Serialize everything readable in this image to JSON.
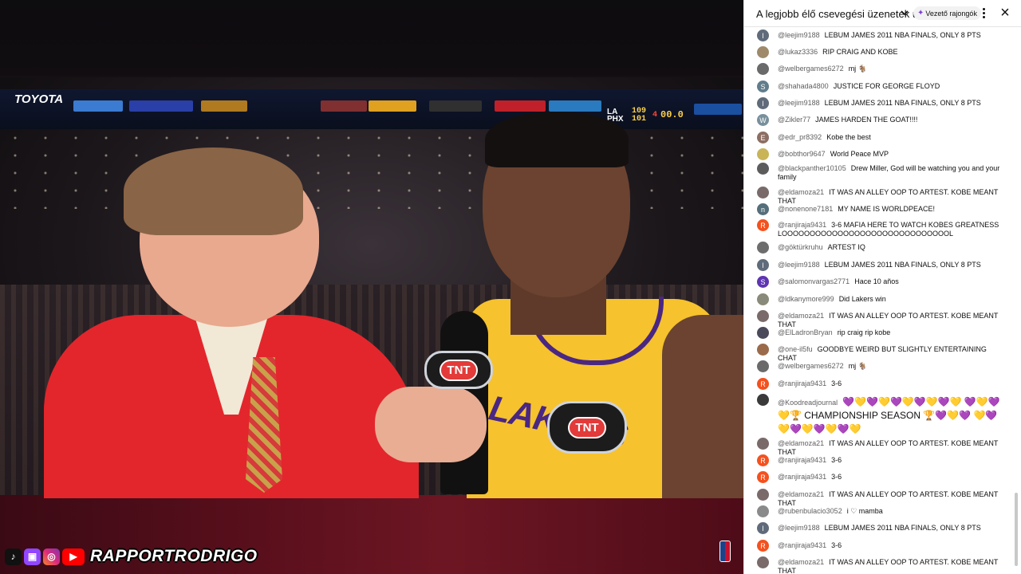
{
  "video": {
    "channel_name": "RAPPORTRODRIGO",
    "social_icons": [
      "tiktok-icon",
      "twitch-icon",
      "instagram-icon",
      "youtube-icon"
    ],
    "broadcast_badge": "TNT",
    "scoreboard_text": [
      "TOYOTA",
      "LA",
      "PHX",
      "109",
      "101",
      "4",
      "00.0"
    ],
    "jersey_text": "LAKERS"
  },
  "chat": {
    "title": "A legjobb élő csevegési üzenetek új...",
    "filter_label": "Vezető rajongók",
    "messages": [
      {
        "author": "@leejim9188",
        "text": "LEBUM JAMES 2011 NBA FINALS, ONLY 8 PTS",
        "avatar_letter": "l",
        "avatar_color": "#5f6b7a"
      },
      {
        "author": "@lukaz3336",
        "text": "RIP CRAIG AND KOBE",
        "avatar_letter": "",
        "avatar_color": "#9e8a6a"
      },
      {
        "author": "@welbergames6272",
        "text": "mj 🐐",
        "avatar_letter": "",
        "avatar_color": "#6a6a6a"
      },
      {
        "author": "@shahada4800",
        "text": "JUSTICE FOR GEORGE FLOYD",
        "avatar_letter": "S",
        "avatar_color": "#607d8b"
      },
      {
        "author": "@leejim9188",
        "text": "LEBUM JAMES 2011 NBA FINALS, ONLY 8 PTS",
        "avatar_letter": "l",
        "avatar_color": "#5f6b7a"
      },
      {
        "author": "@Zikler77",
        "text": "JAMES HARDEN THE GOAT!!!!",
        "avatar_letter": "W",
        "avatar_color": "#78909c"
      },
      {
        "author": "@edr_pr8392",
        "text": "Kobe the best",
        "avatar_letter": "E",
        "avatar_color": "#8d6e63"
      },
      {
        "author": "@bobthor9647",
        "text": "World Peace MVP",
        "avatar_letter": "",
        "avatar_color": "#c9b458"
      },
      {
        "author": "@blackpanther10105",
        "text": "Drew Miller, God will be watching you and your family",
        "avatar_letter": "",
        "avatar_color": "#5c5c5c"
      },
      {
        "author": "@eldamoza21",
        "text": "IT WAS AN ALLEY OOP TO ARTEST. KOBE MEANT THAT",
        "avatar_letter": "",
        "avatar_color": "#7a6a6a"
      },
      {
        "author": "@nonenone7181",
        "text": "MY NAME IS WORLDPEACE!",
        "avatar_letter": "n",
        "avatar_color": "#546e7a"
      },
      {
        "author": "@ranjiraja9431",
        "text": "3-6 MAFIA HERE TO WATCH KOBES GREATNESS LOOOOOOOOOOOOOOOOOOOOOOOOOOOOOOL",
        "avatar_letter": "R",
        "avatar_color": "#f4511e"
      },
      {
        "author": "@göktürkruhu",
        "text": "ARTEST IQ",
        "avatar_letter": "",
        "avatar_color": "#6d6d6d"
      },
      {
        "author": "@leejim9188",
        "text": "LEBUM JAMES 2011 NBA FINALS, ONLY 8 PTS",
        "avatar_letter": "l",
        "avatar_color": "#5f6b7a"
      },
      {
        "author": "@salomonvargas2771",
        "text": "Hace 10 años",
        "avatar_letter": "S",
        "avatar_color": "#5e35b1"
      },
      {
        "author": "@ldkanymore999",
        "text": "Did Lakers win",
        "avatar_letter": "",
        "avatar_color": "#8a8a7a"
      },
      {
        "author": "@eldamoza21",
        "text": "IT WAS AN ALLEY OOP TO ARTEST. KOBE MEANT THAT",
        "avatar_letter": "",
        "avatar_color": "#7a6a6a"
      },
      {
        "author": "@ElLadronBryan",
        "text": "rip craig rip kobe",
        "avatar_letter": "",
        "avatar_color": "#4a4a5a"
      },
      {
        "author": "@one-il5fu",
        "text": "GOODBYE WEIRD BUT SLIGHTLY ENTERTAINING CHAT",
        "avatar_letter": "",
        "avatar_color": "#9a6a4a"
      },
      {
        "author": "@welbergames6272",
        "text": "mj 🐐",
        "avatar_letter": "",
        "avatar_color": "#6a6a6a"
      },
      {
        "author": "@ranjiraja9431",
        "text": "3-6",
        "avatar_letter": "R",
        "avatar_color": "#f4511e"
      },
      {
        "author": "@Koodreadjournal",
        "text": "💜💛💜💛💜💛💜💛💜💛 💜💛💜💛🏆 CHAMPIONSHIP SEASON 🏆💜💛💜 💛💜💛💜💛💜💛💜💛",
        "avatar_letter": "",
        "avatar_color": "#3a3a3a"
      },
      {
        "author": "@eldamoza21",
        "text": "IT WAS AN ALLEY OOP TO ARTEST. KOBE MEANT THAT",
        "avatar_letter": "",
        "avatar_color": "#7a6a6a"
      },
      {
        "author": "@ranjiraja9431",
        "text": "3-6",
        "avatar_letter": "R",
        "avatar_color": "#f4511e"
      },
      {
        "author": "@ranjiraja9431",
        "text": "3-6",
        "avatar_letter": "R",
        "avatar_color": "#f4511e"
      },
      {
        "author": "@eldamoza21",
        "text": "IT WAS AN ALLEY OOP TO ARTEST. KOBE MEANT THAT",
        "avatar_letter": "",
        "avatar_color": "#7a6a6a"
      },
      {
        "author": "@rubenbulacio3052",
        "text": "i ♡ mamba",
        "avatar_letter": "",
        "avatar_color": "#8a8a8a"
      },
      {
        "author": "@leejim9188",
        "text": "LEBUM JAMES 2011 NBA FINALS, ONLY 8 PTS",
        "avatar_letter": "l",
        "avatar_color": "#5f6b7a"
      },
      {
        "author": "@ranjiraja9431",
        "text": "3-6",
        "avatar_letter": "R",
        "avatar_color": "#f4511e"
      },
      {
        "author": "@eldamoza21",
        "text": "IT WAS AN ALLEY OOP TO ARTEST. KOBE MEANT THAT",
        "avatar_letter": "",
        "avatar_color": "#7a6a6a"
      }
    ]
  }
}
